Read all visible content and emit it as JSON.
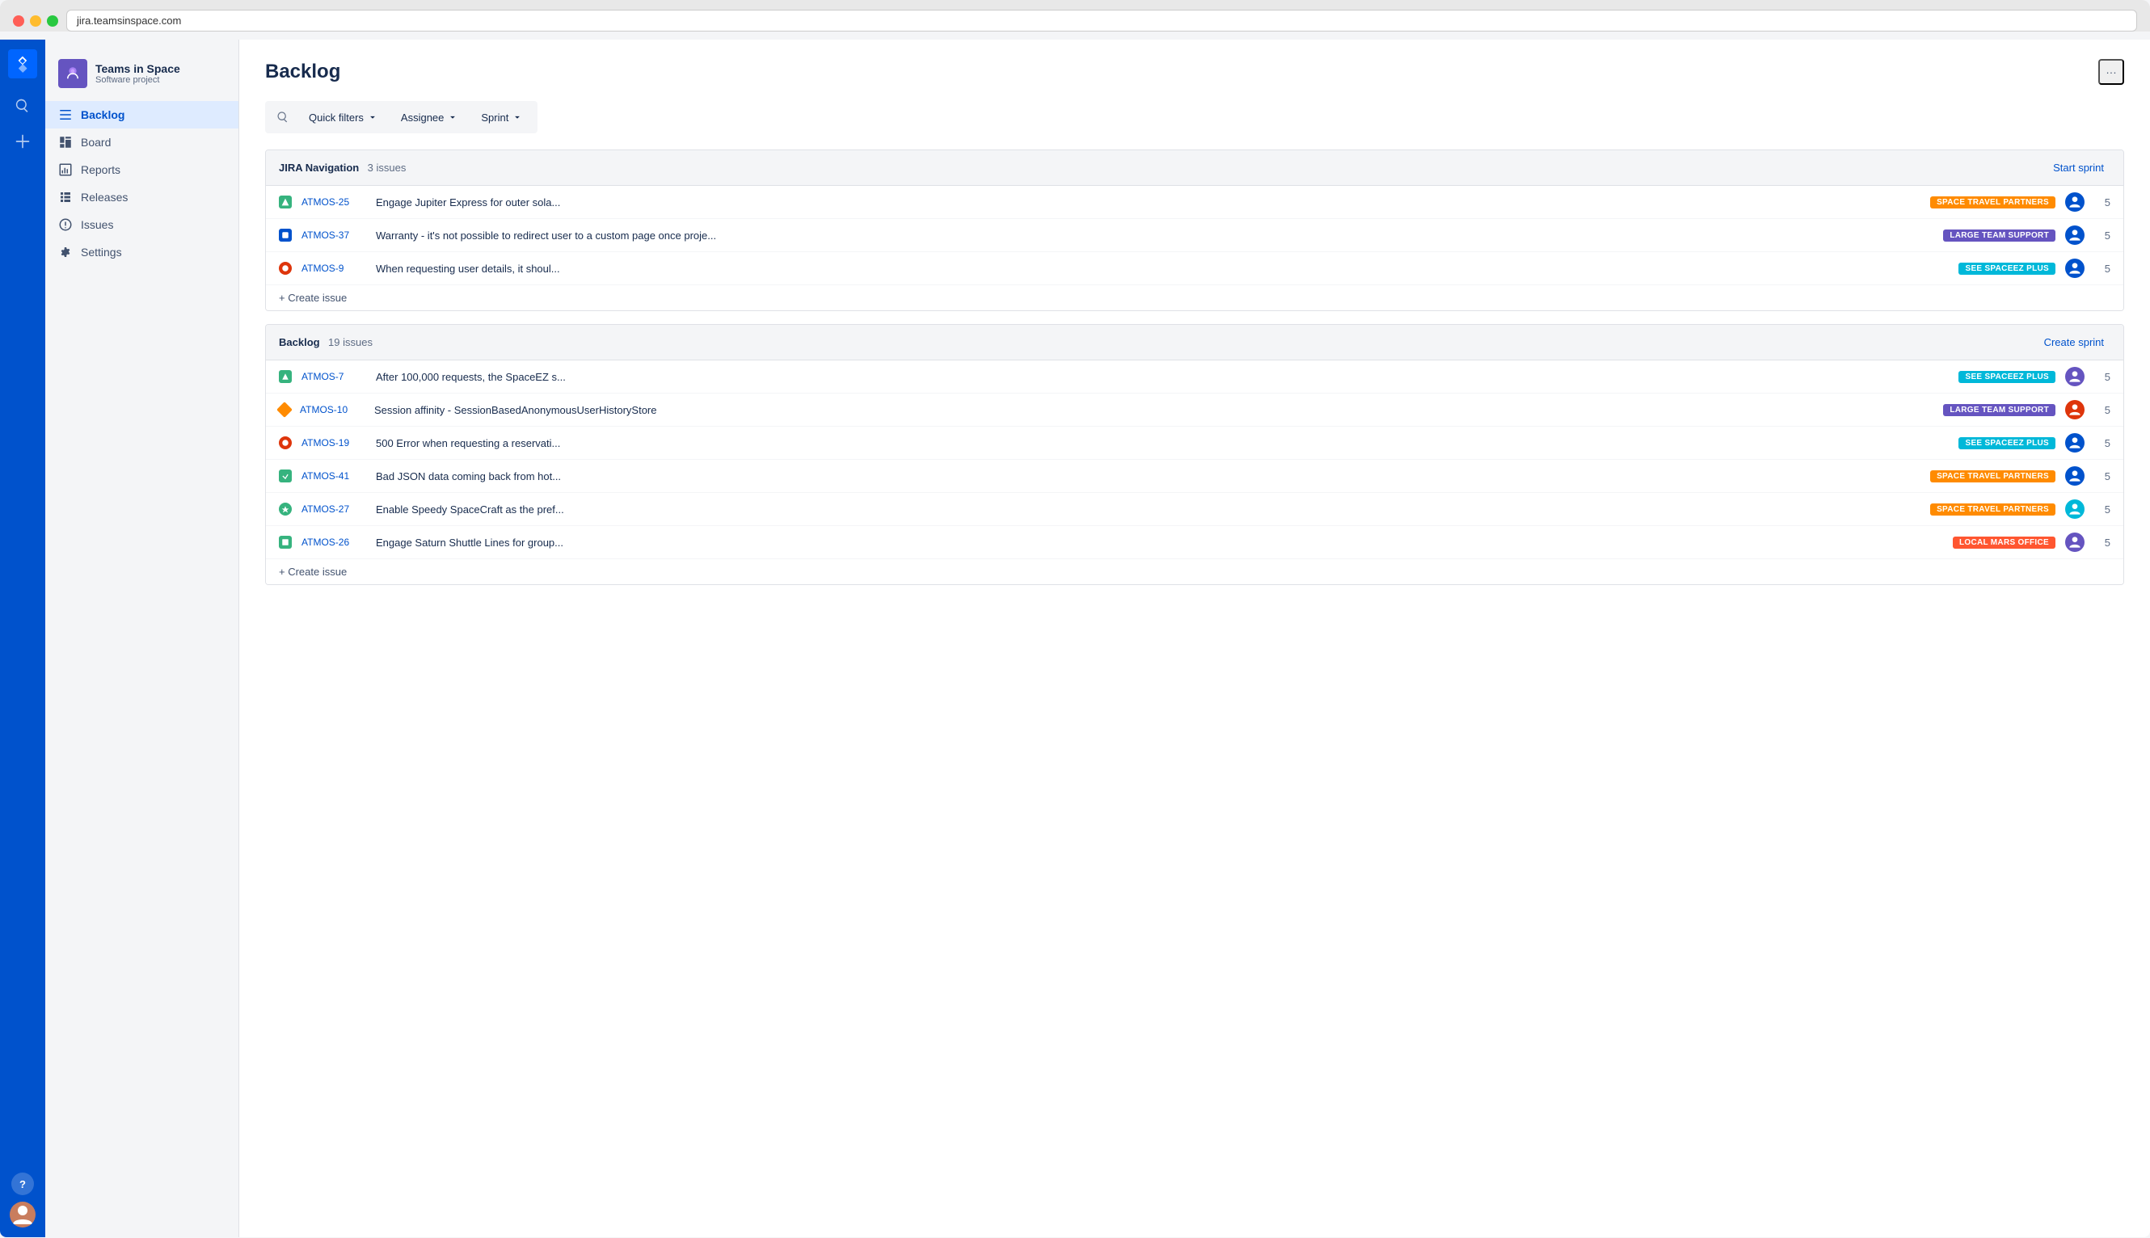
{
  "browser": {
    "url": "jira.teamsinspace.com"
  },
  "project": {
    "name": "Teams in Space",
    "type": "Software project"
  },
  "page": {
    "title": "Backlog",
    "more_label": "···"
  },
  "filters": {
    "search_placeholder": "Search",
    "quick_filters_label": "Quick filters",
    "assignee_label": "Assignee",
    "sprint_label": "Sprint"
  },
  "sidebar": {
    "items": [
      {
        "id": "backlog",
        "label": "Backlog",
        "active": true
      },
      {
        "id": "board",
        "label": "Board",
        "active": false
      },
      {
        "id": "reports",
        "label": "Reports",
        "active": false
      },
      {
        "id": "releases",
        "label": "Releases",
        "active": false
      },
      {
        "id": "issues",
        "label": "Issues",
        "active": false
      },
      {
        "id": "settings",
        "label": "Settings",
        "active": false
      }
    ]
  },
  "sprints": [
    {
      "id": "jira-navigation",
      "title": "JIRA Navigation",
      "issue_count": "3 issues",
      "action_label": "Start sprint",
      "issues": [
        {
          "key": "ATMOS-25",
          "type": "story",
          "type_color": "#36b37e",
          "summary": "Engage Jupiter Express for outer sola...",
          "label": "SPACE TRAVEL PARTNERS",
          "label_class": "label-space-travel",
          "points": "5"
        },
        {
          "key": "ATMOS-37",
          "type": "subtask",
          "type_color": "#0052cc",
          "summary": "Warranty - it's not possible to redirect user to a custom page once proje...",
          "label": "LARGE TEAM SUPPORT",
          "label_class": "label-large-team",
          "points": "5"
        },
        {
          "key": "ATMOS-9",
          "type": "bug",
          "type_color": "#de350b",
          "summary": "When requesting user details, it shoul...",
          "label": "SEE SPACEEZ PLUS",
          "label_class": "label-see-spaceez",
          "points": "5"
        }
      ],
      "create_issue_label": "+ Create issue"
    },
    {
      "id": "backlog",
      "title": "Backlog",
      "issue_count": "19 issues",
      "action_label": "Create sprint",
      "issues": [
        {
          "key": "ATMOS-7",
          "type": "story",
          "type_color": "#36b37e",
          "summary": "After 100,000 requests, the SpaceEZ s...",
          "label": "SEE SPACEEZ PLUS",
          "label_class": "label-see-spaceez",
          "points": "5"
        },
        {
          "key": "ATMOS-10",
          "type": "improvement",
          "type_color": "#ff8b00",
          "summary": "Session affinity - SessionBasedAnonymousUserHistoryStore",
          "label": "LARGE TEAM SUPPORT",
          "label_class": "label-large-team",
          "points": "5"
        },
        {
          "key": "ATMOS-19",
          "type": "bug",
          "type_color": "#de350b",
          "summary": "500 Error when requesting a reservati...",
          "label": "SEE SPACEEZ PLUS",
          "label_class": "label-see-spaceez",
          "points": "5"
        },
        {
          "key": "ATMOS-41",
          "type": "story",
          "type_color": "#36b37e",
          "summary": "Bad JSON data coming back from hot...",
          "label": "SPACE TRAVEL PARTNERS",
          "label_class": "label-space-travel",
          "points": "5"
        },
        {
          "key": "ATMOS-27",
          "type": "improvement",
          "type_color": "#36b37e",
          "summary": "Enable Speedy SpaceCraft as the pref...",
          "label": "SPACE TRAVEL PARTNERS",
          "label_class": "label-space-travel",
          "points": "5"
        },
        {
          "key": "ATMOS-26",
          "type": "story",
          "type_color": "#36b37e",
          "summary": "Engage Saturn Shuttle Lines for group...",
          "label": "LOCAL MARS OFFICE",
          "label_class": "label-local-mars",
          "points": "5"
        }
      ],
      "create_issue_label": "+ Create issue"
    }
  ]
}
